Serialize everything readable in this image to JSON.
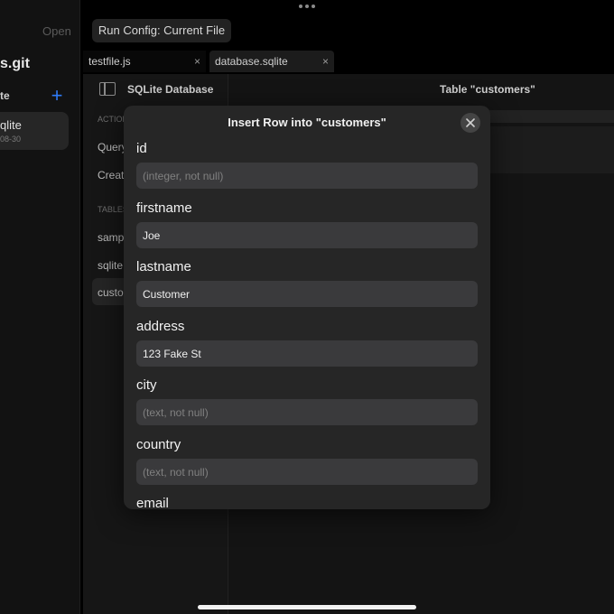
{
  "sidebar": {
    "open_label": "Open",
    "repo_title": "s.git",
    "section_label": "te",
    "add_icon": "plus-icon",
    "file_item": {
      "name": "qlite",
      "date": "08-30"
    }
  },
  "toolbar": {
    "more_icon": "ellipsis-icon",
    "run_config_label": "Run Config: Current File"
  },
  "tabs": [
    {
      "label": "testfile.js",
      "close": "×"
    },
    {
      "label": "database.sqlite",
      "close": "×"
    }
  ],
  "db_panel": {
    "title": "SQLite Database",
    "actions_label": "ACTION",
    "actions": [
      "Query",
      "Creat"
    ],
    "tables_label": "TABLES",
    "tables": [
      "samp",
      "sqlite",
      "custo"
    ]
  },
  "table_view": {
    "title": "Table \"customers\""
  },
  "modal": {
    "title": "Insert Row into \"customers\"",
    "close_icon": "close-icon",
    "fields": [
      {
        "label": "id",
        "value": "",
        "placeholder": "(integer, not null)"
      },
      {
        "label": "firstname",
        "value": "Joe",
        "placeholder": ""
      },
      {
        "label": "lastname",
        "value": "Customer",
        "placeholder": ""
      },
      {
        "label": "address",
        "value": "123 Fake St",
        "placeholder": ""
      },
      {
        "label": "city",
        "value": "",
        "placeholder": "(text, not null)"
      },
      {
        "label": "country",
        "value": "",
        "placeholder": "(text, not null)"
      },
      {
        "label": "email",
        "value": "",
        "placeholder": ""
      }
    ]
  },
  "colors": {
    "accent": "#2f7bf6",
    "background": "#000000",
    "modal": "#262626",
    "input": "#3a3a3c"
  }
}
